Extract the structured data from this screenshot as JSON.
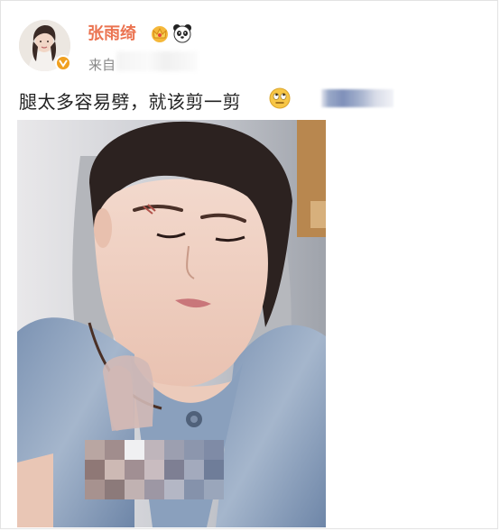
{
  "post": {
    "username": "张雨绮",
    "source_prefix": "来自",
    "text": "腿太多容易劈，就该剪一剪",
    "badges": [
      "crown-badge-icon",
      "panda-badge-icon"
    ],
    "text_emoji": "eye-roll-emoji-icon",
    "verified_badge": "verified-v-icon"
  },
  "colors": {
    "username": "#eb7350",
    "verified": "#f0a020",
    "text": "#222222",
    "source": "#888888"
  }
}
